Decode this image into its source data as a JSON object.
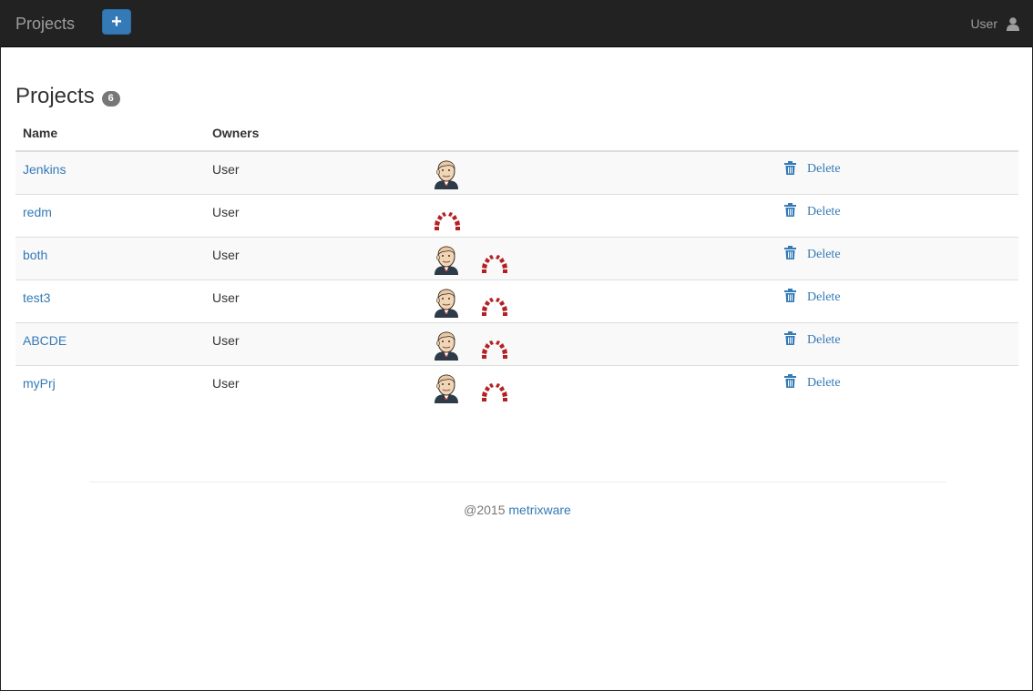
{
  "navbar": {
    "brand": "Projects",
    "add_label": "+",
    "user_label": "User"
  },
  "page": {
    "title": "Projects",
    "count": "6"
  },
  "table": {
    "headers": {
      "name": "Name",
      "owners": "Owners",
      "tools": "",
      "actions": ""
    },
    "rows": [
      {
        "name": "Jenkins",
        "owner": "User",
        "tools": [
          "jenkins-icon"
        ],
        "action": "Delete"
      },
      {
        "name": "redm",
        "owner": "User",
        "tools": [
          "redmine-icon"
        ],
        "action": "Delete"
      },
      {
        "name": "both",
        "owner": "User",
        "tools": [
          "jenkins-icon",
          "redmine-icon"
        ],
        "action": "Delete"
      },
      {
        "name": "test3",
        "owner": "User",
        "tools": [
          "jenkins-icon",
          "redmine-icon"
        ],
        "action": "Delete"
      },
      {
        "name": "ABCDE",
        "owner": "User",
        "tools": [
          "jenkins-icon",
          "redmine-icon"
        ],
        "action": "Delete"
      },
      {
        "name": "myPrj",
        "owner": "User",
        "tools": [
          "jenkins-icon",
          "redmine-icon"
        ],
        "action": "Delete"
      }
    ]
  },
  "footer": {
    "copyright": "@2015",
    "link": "metrixware"
  },
  "colors": {
    "navbar_bg": "#222222",
    "primary": "#337ab7",
    "badge": "#777777",
    "redmine": "#b32024"
  }
}
